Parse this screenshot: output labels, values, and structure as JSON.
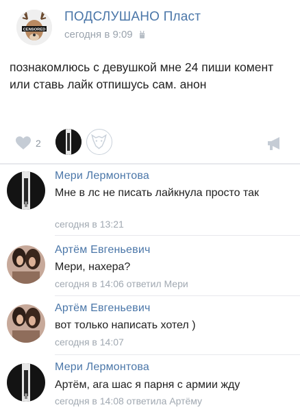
{
  "post": {
    "group_name": "ПОДСЛУШАНО Пласт",
    "group_logo_text": "CENSORED",
    "time": "сегодня в 9:09",
    "text": "познакомлюсь с девушкой  мне 24 пиши комент или ставь лайк отпишусь сам. анон",
    "likes_count": "2"
  },
  "icons": {
    "device": "phone-icon",
    "like": "heart-icon",
    "share": "megaphone-icon"
  },
  "colors": {
    "link": "#4a76a8",
    "meta": "#a0a8b1",
    "divider": "#e7e8ec"
  },
  "comments": [
    {
      "author": "Мери Лермонтова",
      "text": "Мне в лс не писать лайкнула просто так",
      "meta": "сегодня в 13:21"
    },
    {
      "author": "Артём Евгеньевич",
      "text": "Мери, нахера?",
      "meta": "сегодня в 14:06 ответил Мери"
    },
    {
      "author": "Артём Евгеньевич",
      "text": "вот только написать хотел )",
      "meta": "сегодня в 14:07"
    },
    {
      "author": "Мери Лермонтова",
      "text": "Артём, ага шас я парня с армии жду",
      "meta": "сегодня в 14:08 ответила Артёму"
    }
  ]
}
